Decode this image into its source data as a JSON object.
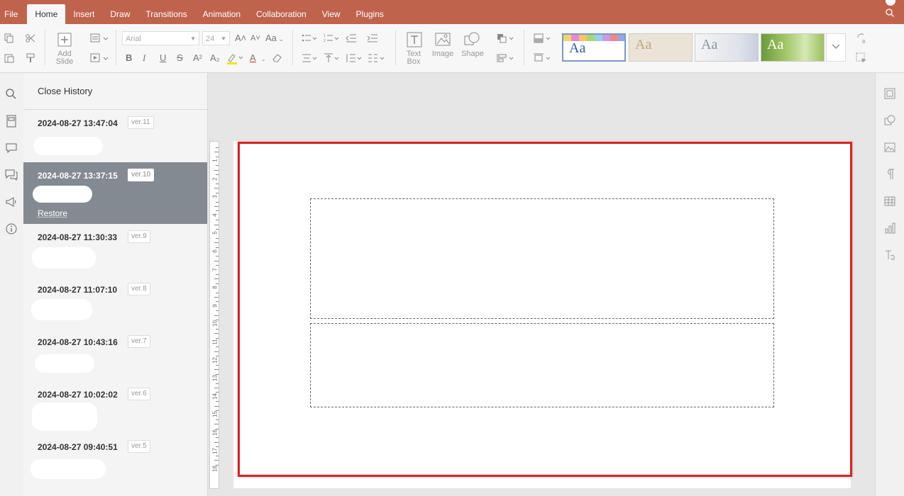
{
  "menu": {
    "items": [
      "File",
      "Home",
      "Insert",
      "Draw",
      "Transitions",
      "Animation",
      "Collaboration",
      "View",
      "Plugins"
    ],
    "active": "Home"
  },
  "toolbar": {
    "font_name": "Arial",
    "font_size": "24",
    "add_slide_label": "Add Slide",
    "text_box_label": "Text Box",
    "image_label": "Image",
    "shape_label": "Shape",
    "bold": "B",
    "italic": "I",
    "underline": "U",
    "strike": "S",
    "superscript": "A²",
    "subscript": "A₂",
    "increase_font": "A˄",
    "decrease_font": "A˅",
    "change_case": "Aa",
    "font_color": "A",
    "themes": [
      "Aa",
      "Aa",
      "Aa",
      "Aa"
    ]
  },
  "history": {
    "close_label": "Close History",
    "restore_label": "Restore",
    "versions": [
      {
        "date": "2024-08-27 13:47:04",
        "version": "ver.11"
      },
      {
        "date": "2024-08-27 13:37:15",
        "version": "ver.10"
      },
      {
        "date": "2024-08-27 11:30:33",
        "version": "ver.9"
      },
      {
        "date": "2024-08-27 11:07:10",
        "version": "ver.8"
      },
      {
        "date": "2024-08-27 10:43:16",
        "version": "ver.7"
      },
      {
        "date": "2024-08-27 10:02:02",
        "version": "ver.6"
      },
      {
        "date": "2024-08-27 09:40:51",
        "version": "ver.5"
      }
    ],
    "selected_version": "ver.10"
  },
  "ruler": {
    "labels": [
      "1",
      "2",
      "3",
      "4",
      "5",
      "6",
      "7",
      "8",
      "9",
      "10",
      "11",
      "12",
      "13",
      "14",
      "15",
      "16",
      "17",
      "18"
    ]
  },
  "colors": {
    "menubar": "#c0634d",
    "selected_version_bg": "#848a92",
    "highlight_border": "#e02020"
  }
}
